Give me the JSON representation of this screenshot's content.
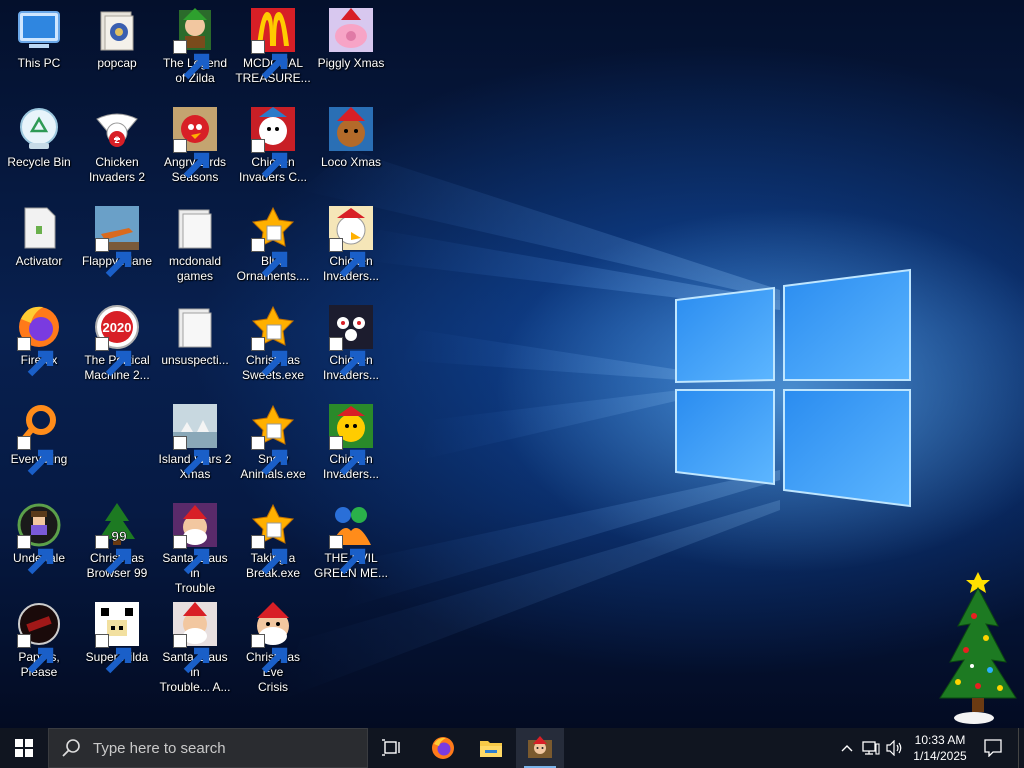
{
  "desktop": {
    "icons": [
      {
        "label": "This PC"
      },
      {
        "label": "popcap"
      },
      {
        "label": "The Legend\nof Zilda"
      },
      {
        "label": "MCDONAL\nTREASURE..."
      },
      {
        "label": "Piggly Xmas"
      },
      {
        "label": "Recycle Bin"
      },
      {
        "label": "Chicken\nInvaders 2"
      },
      {
        "label": "Angry Birds\nSeasons"
      },
      {
        "label": "Chicken\nInvaders C..."
      },
      {
        "label": "Loco Xmas"
      },
      {
        "label": "Activator"
      },
      {
        "label": "Flappy Plane"
      },
      {
        "label": "mcdonald\ngames"
      },
      {
        "label": "Blue\nOrnaments...."
      },
      {
        "label": "Chicken\nInvaders..."
      },
      {
        "label": "Firefox"
      },
      {
        "label": "The Political\nMachine 2..."
      },
      {
        "label": "unsuspecti..."
      },
      {
        "label": "Christmas\nSweets.exe"
      },
      {
        "label": "Chicken\nInvaders..."
      },
      {
        "label": "Everything"
      },
      {
        "label": "Island Wars 2\nXmas"
      },
      {
        "label": "Snow\nAnimals.exe"
      },
      {
        "label": "Chicken\nInvaders..."
      },
      {
        "label": "Undertale"
      },
      {
        "label": "Christmas\nBrowser 99"
      },
      {
        "label": "Santa Claus in\nTrouble"
      },
      {
        "label": "Taking a\nBreak.exe"
      },
      {
        "label": "THE EVIL\nGREEN ME..."
      },
      {
        "label": "Papers, Please"
      },
      {
        "label": "Super Hilda"
      },
      {
        "label": "Santa Claus in\nTrouble... A..."
      },
      {
        "label": "Christmas Eve\nCrisis"
      }
    ],
    "political_badge_text": "2020",
    "browser_badge_text": "99",
    "chicken_badge_text": "2"
  },
  "taskbar": {
    "search_placeholder": "Type here to search",
    "clock_time": "10:33 AM",
    "clock_date": "1/14/2025",
    "apps": [
      "firefox-icon",
      "file-explorer-icon",
      "game-icon"
    ]
  },
  "colors": {
    "accent": "#0a6cd8",
    "taskbar": "#101520"
  }
}
